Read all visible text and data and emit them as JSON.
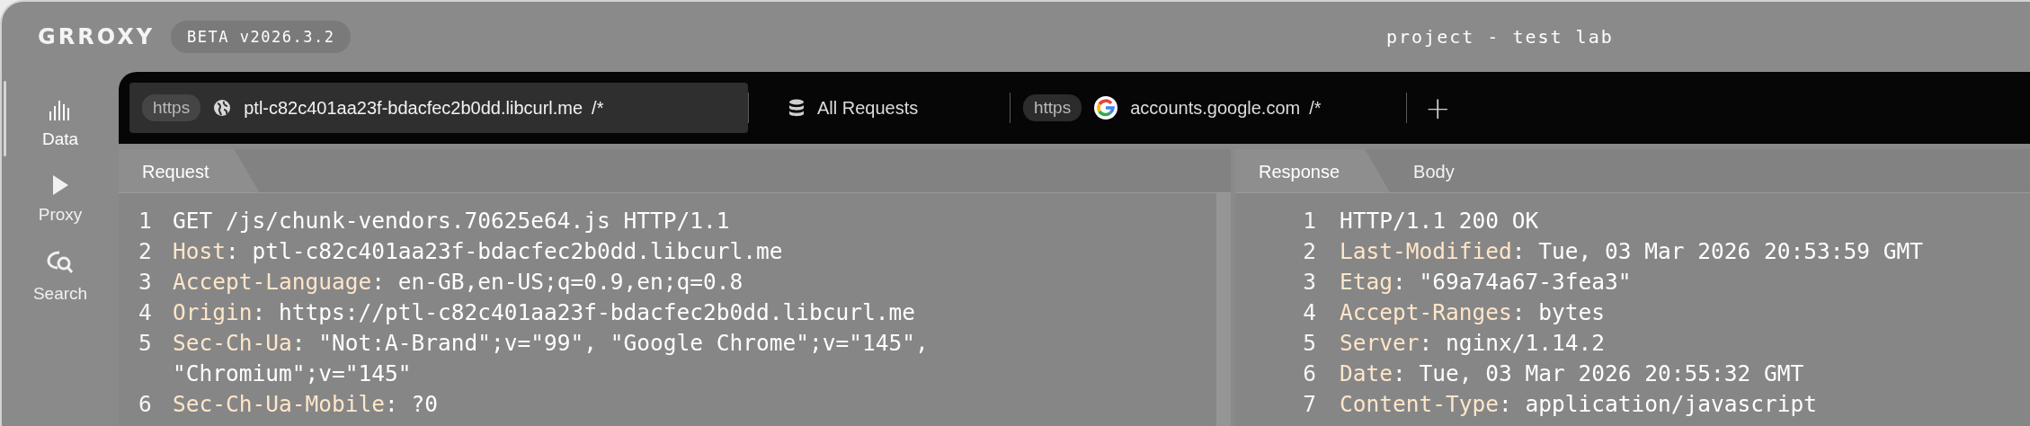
{
  "app": {
    "logo": "GRROXY",
    "version": "BETA v2026.3.2",
    "title": "project - test lab"
  },
  "sidebar": [
    {
      "kind": "data",
      "label": "Data",
      "selected": true
    },
    {
      "kind": "proxy",
      "label": "Proxy",
      "selected": false
    },
    {
      "kind": "search",
      "label": "Search",
      "selected": false
    }
  ],
  "tabs": [
    {
      "kind": "host",
      "scheme": "https",
      "host": "ptl-c82c401aa23f-bdacfec2b0dd.libcurl.me",
      "path": "/*",
      "selected": true
    },
    {
      "kind": "all",
      "label": "All Requests",
      "selected": false
    },
    {
      "kind": "host",
      "scheme": "https",
      "host": "accounts.google.com",
      "path": "/*",
      "selected": false
    }
  ],
  "add_tab": "+",
  "request": {
    "tabs": [
      {
        "label": "Request",
        "selected": true
      }
    ],
    "lines": [
      {
        "number": "1",
        "value": "GET /js/chunk-vendors.70625e64.js HTTP/1.1"
      },
      {
        "number": "2",
        "key": "Host",
        "value": ": ptl-c82c401aa23f-bdacfec2b0dd.libcurl.me"
      },
      {
        "number": "3",
        "key": "Accept-Language",
        "value": ": en-GB,en-US;q=0.9,en;q=0.8"
      },
      {
        "number": "4",
        "key": "Origin",
        "value": ": https://ptl-c82c401aa23f-bdacfec2b0dd.libcurl.me"
      },
      {
        "number": "5",
        "key": "Sec-Ch-Ua",
        "value": ": \"Not:A-Brand\";v=\"99\", \"Google Chrome\";v=\"145\", \"Chromium\";v=\"145\""
      },
      {
        "number": "6",
        "key": "Sec-Ch-Ua-Mobile",
        "value": ": ?0"
      }
    ]
  },
  "response": {
    "tabs": [
      {
        "label": "Response",
        "selected": true
      },
      {
        "label": "Body",
        "selected": false
      }
    ],
    "lines": [
      {
        "number": "1",
        "value": "HTTP/1.1 200 OK"
      },
      {
        "number": "2",
        "key": "Last-Modified",
        "value": ": Tue, 03 Mar 2026 20:53:59 GMT"
      },
      {
        "number": "3",
        "key": "Etag",
        "value": ": \"69a74a67-3fea3\""
      },
      {
        "number": "4",
        "key": "Accept-Ranges",
        "value": ": bytes"
      },
      {
        "number": "5",
        "key": "Server",
        "value": ": nginx/1.14.2"
      },
      {
        "number": "6",
        "key": "Date",
        "value": ": Tue, 03 Mar 2026 20:55:32 GMT"
      },
      {
        "number": "7",
        "key": "Content-Type",
        "value": ": application/javascript"
      }
    ]
  }
}
